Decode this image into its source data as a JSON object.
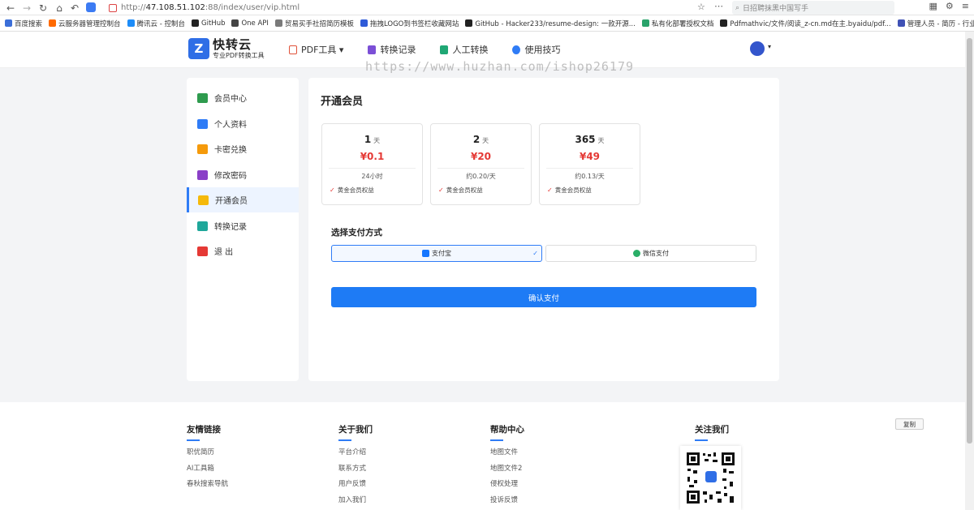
{
  "browser": {
    "url_prefix": "http://",
    "url_host": "47.108.51.102",
    "url_path": ":88/index/user/vip.html",
    "search_placeholder": "日招聘抹黑中国写手"
  },
  "bookmarks": [
    {
      "label": "百度搜索",
      "color": "#3b6ed8"
    },
    {
      "label": "云服务器管理控制台",
      "color": "#ff6a00"
    },
    {
      "label": "腾讯云 - 控制台",
      "color": "#1d8cf8"
    },
    {
      "label": "GitHub",
      "color": "#222222"
    },
    {
      "label": "One API",
      "color": "#444444"
    },
    {
      "label": "贸易买手社招简历模板",
      "color": "#7a7a7a"
    },
    {
      "label": "拖拽LOGO到书签栏收藏网站",
      "color": "#2f5bd8"
    },
    {
      "label": "GitHub - Hacker233/resume-design: 一款开源...",
      "color": "#222222"
    },
    {
      "label": "私有化部署授权文档",
      "color": "#2aa36b"
    },
    {
      "label": "Pdfmathvic/文件/阅读_z-cn.md在主.byaidu/pdf...",
      "color": "#222222"
    },
    {
      "label": "管理人员 - 简历 - 行业词库 - 星网大数据",
      "color": "#3f51b5"
    }
  ],
  "header": {
    "logo_mark": "Z",
    "logo_title": "快转云",
    "logo_sub": "专业PDF转换工具",
    "nav": [
      {
        "label": "PDF工具 ▾",
        "color": "#e0523a"
      },
      {
        "label": "转换记录",
        "color": "#7b4fd6"
      },
      {
        "label": "人工转换",
        "color": "#1fa774"
      },
      {
        "label": "使用技巧",
        "color": "#2f7cf6"
      }
    ]
  },
  "watermark": "https://www.huzhan.com/ishop26179",
  "sidebar": {
    "items": [
      {
        "label": "会员中心",
        "icon": "home-icon",
        "color": "#2e9b4e"
      },
      {
        "label": "个人资料",
        "icon": "user-icon",
        "color": "#2f7cf6"
      },
      {
        "label": "卡密兑换",
        "icon": "ticket-icon",
        "color": "#f59a0b"
      },
      {
        "label": "修改密码",
        "icon": "key-icon",
        "color": "#8a3fc7"
      },
      {
        "label": "开通会员",
        "icon": "crown-icon",
        "color": "#f5b90b"
      },
      {
        "label": "转换记录",
        "icon": "file-export-icon",
        "color": "#1fa79a"
      },
      {
        "label": "退 出",
        "icon": "logout-icon",
        "color": "#e53935"
      }
    ]
  },
  "main": {
    "title": "开通会员",
    "plans": [
      {
        "days": "1",
        "unit": "天",
        "price": "¥0.1",
        "note": "24小时",
        "perk": "黄金会员权益"
      },
      {
        "days": "2",
        "unit": "天",
        "price": "¥20",
        "note": "约0.20/天",
        "perk": "黄金会员权益"
      },
      {
        "days": "365",
        "unit": "天",
        "price": "¥49",
        "note": "约0.13/天",
        "perk": "黄金会员权益"
      }
    ],
    "pay_label": "选择支付方式",
    "pay_options": [
      {
        "label": "支付宝",
        "color": "#1677ff",
        "selected": true
      },
      {
        "label": "微信支付",
        "color": "#2aae67",
        "selected": false
      }
    ],
    "confirm_label": "确认支付"
  },
  "footer": {
    "columns": [
      {
        "title": "友情链接",
        "links": [
          "职优简历",
          "AI工具箱",
          "春秋搜索导航"
        ]
      },
      {
        "title": "关于我们",
        "links": [
          "平台介绍",
          "联系方式",
          "用户反馈",
          "加入我们"
        ]
      },
      {
        "title": "帮助中心",
        "links": [
          "地图文件",
          "地图文件2",
          "侵权处理",
          "投诉反馈"
        ]
      },
      {
        "title": "关注我们",
        "links": []
      }
    ],
    "copy_label": "复制"
  }
}
